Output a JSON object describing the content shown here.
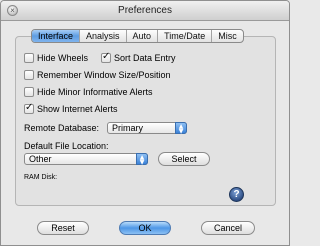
{
  "window": {
    "title": "Preferences"
  },
  "tabs": [
    {
      "label": "Interface",
      "active": true
    },
    {
      "label": "Analysis",
      "active": false
    },
    {
      "label": "Auto",
      "active": false
    },
    {
      "label": "Time/Date",
      "active": false
    },
    {
      "label": "Misc",
      "active": false
    }
  ],
  "checkboxes": [
    {
      "label": "Hide Wheels",
      "checked": false
    },
    {
      "label": "Sort Data Entry",
      "checked": true
    },
    {
      "label": "Remember Window Size/Position",
      "checked": false
    },
    {
      "label": "Hide Minor Informative Alerts",
      "checked": false
    },
    {
      "label": "Show Internet Alerts",
      "checked": true
    }
  ],
  "remote_database": {
    "label": "Remote Database:",
    "value": "Primary"
  },
  "default_file_location": {
    "label": "Default File Location:",
    "value": "Other",
    "select_label": "Select"
  },
  "ram_disk": {
    "label": "RAM Disk:"
  },
  "help": {
    "symbol": "?"
  },
  "buttons": {
    "reset": "Reset",
    "ok": "OK",
    "cancel": "Cancel"
  },
  "icons": {
    "close": "close-icon",
    "help": "help-icon",
    "popup_arrow": "updown-arrow-icon",
    "check": "check-icon"
  },
  "colors": {
    "accent": "#5e9de2",
    "window_bg": "#e8e8e8"
  }
}
